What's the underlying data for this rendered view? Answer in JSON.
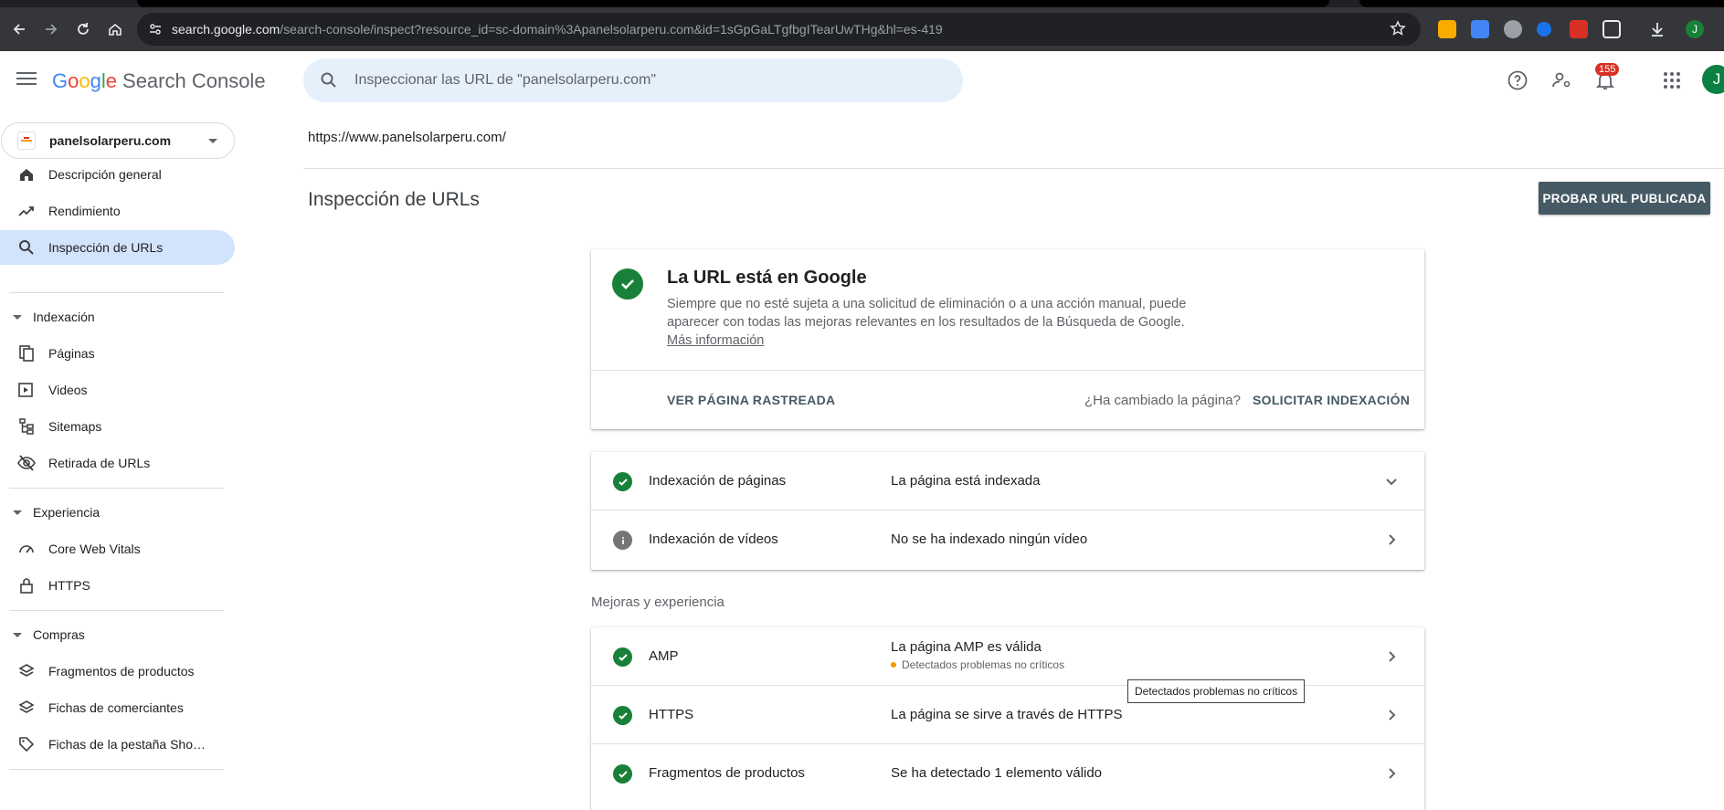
{
  "browser": {
    "url_host": "search.google.com",
    "url_path": "/search-console/inspect?resource_id=sc-domain%3Apanelsolarperu.com&id=1sGpGaLTgfbgITearUwTHg&hl=es-419",
    "avatar_letter": "J"
  },
  "header": {
    "logo_google": [
      "G",
      "o",
      "o",
      "g",
      "l",
      "e"
    ],
    "logo_product": "Search Console",
    "search_placeholder": "Inspeccionar las URL de \"panelsolarperu.com\"",
    "notifications_count": "155",
    "avatar_letter": "J"
  },
  "sidebar": {
    "property": "panelsolarperu.com",
    "items_top": [
      {
        "label": "Descripción general",
        "icon": "home-icon"
      },
      {
        "label": "Rendimiento",
        "icon": "trending-up-icon"
      },
      {
        "label": "Inspección de URLs",
        "icon": "search-icon",
        "active": true
      }
    ],
    "sections": [
      {
        "label": "Indexación",
        "items": [
          {
            "label": "Páginas",
            "icon": "pages-icon"
          },
          {
            "label": "Videos",
            "icon": "video-icon"
          },
          {
            "label": "Sitemaps",
            "icon": "sitemap-icon"
          },
          {
            "label": "Retirada de URLs",
            "icon": "visibility-off-icon"
          }
        ]
      },
      {
        "label": "Experiencia",
        "items": [
          {
            "label": "Core Web Vitals",
            "icon": "speed-icon"
          },
          {
            "label": "HTTPS",
            "icon": "lock-icon"
          }
        ]
      },
      {
        "label": "Compras",
        "items": [
          {
            "label": "Fragmentos de productos",
            "icon": "layers-icon"
          },
          {
            "label": "Fichas de comerciantes",
            "icon": "layers-icon"
          },
          {
            "label": "Fichas de la pestaña Sho…",
            "icon": "tag-icon"
          }
        ]
      }
    ]
  },
  "main": {
    "inspected_url": "https://www.panelsolarperu.com/",
    "title": "Inspección de URLs",
    "test_live_button": "PROBAR URL PUBLICADA",
    "status": {
      "title": "La URL está en Google",
      "description": "Siempre que no esté sujeta a una solicitud de eliminación o a una acción manual, puede aparecer con todas las mejoras relevantes en los resultados de la Búsqueda de Google.",
      "link": "Más información",
      "view_crawled": "VER PÁGINA RASTREADA",
      "changed_question": "¿Ha cambiado la página?",
      "request_indexing": "SOLICITAR INDEXACIÓN"
    },
    "indexing_rows": [
      {
        "name": "Indexación de páginas",
        "value": "La página está indexada",
        "status": "ok",
        "chevron": "chevron-down-icon"
      },
      {
        "name": "Indexación de vídeos",
        "value": "No se ha indexado ningún vídeo",
        "status": "info",
        "chevron": "chevron-right-icon"
      }
    ],
    "enhancements_label": "Mejoras y experiencia",
    "enhancement_rows": [
      {
        "name": "AMP",
        "value": "La página AMP es válida",
        "sub": "Detectados problemas no críticos",
        "status": "ok"
      },
      {
        "name": "HTTPS",
        "value": "La página se sirve a través de HTTPS",
        "status": "ok"
      },
      {
        "name": "Fragmentos de productos",
        "value": "Se ha detectado 1 elemento válido",
        "status": "ok"
      }
    ],
    "tooltip": "Detectados problemas no críticos"
  },
  "colors": {
    "success": "#188038",
    "active_nav": "#d2e3fc",
    "button_dark": "#455a64",
    "badge": "#d93025",
    "warning_dot": "#f29900"
  }
}
